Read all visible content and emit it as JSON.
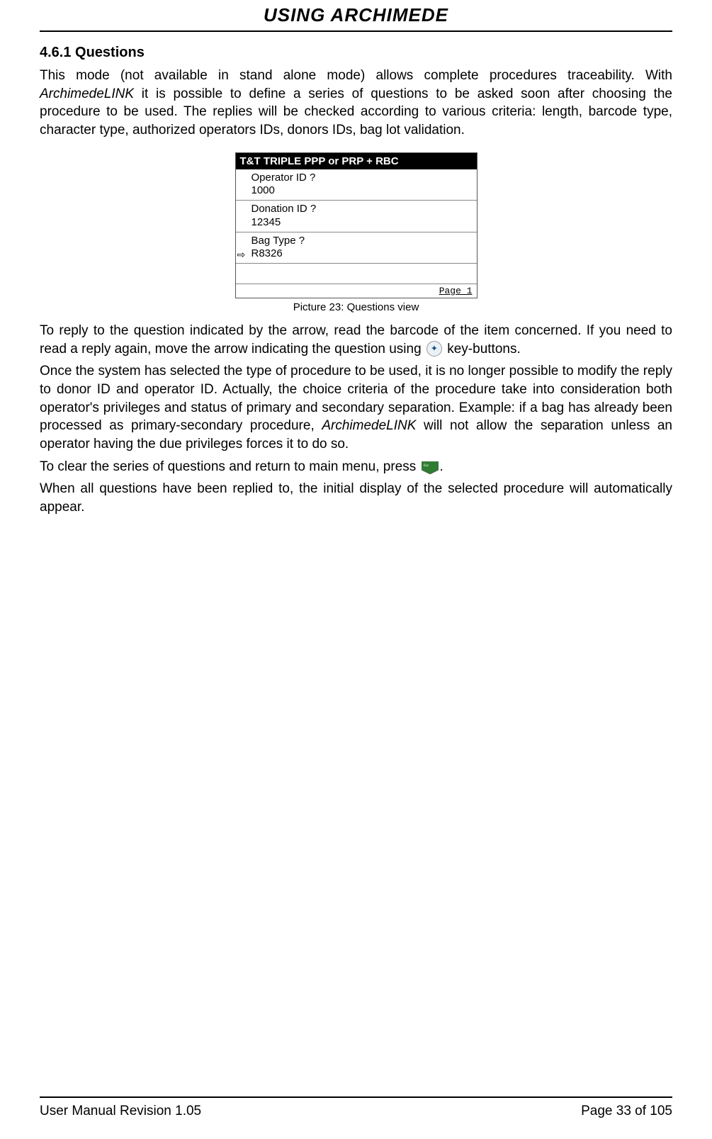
{
  "header": {
    "title": "USING ARCHIMEDE"
  },
  "section": {
    "number_title": "4.6.1 Questions"
  },
  "paragraphs": {
    "p1a": "This mode (not available in stand alone mode) allows complete procedures traceability. With ",
    "p1b": "ArchimedeLINK",
    "p1c": " it is possible to define a series of questions to be asked soon after choosing the procedure to be used. The replies will be checked according to various criteria: length, barcode type, character type, authorized operators IDs, donors IDs, bag lot validation.",
    "p2a": "To reply to the question indicated by the arrow, read the barcode of the item concerned. If you need to read a reply again, move the arrow indicating the question using ",
    "p2b": " key-buttons.",
    "p3a": "Once the system has selected the type of procedure to be used, it is no longer possible to modify the reply to donor ID and operator ID. Actually, the choice criteria of the procedure take into consideration both operator's privileges and status of primary and secondary separation. Example: if a bag has already been processed as primary-secondary procedure, ",
    "p3b": "ArchimedeLINK",
    "p3c": " will not allow the separation unless an operator having the due privileges forces it to do so.",
    "p4a": "To clear the series of questions and return to main menu, press ",
    "p4b": ".",
    "p5": "When all questions have been replied to, the initial display of the selected procedure will automatically appear."
  },
  "figure": {
    "caption": "Picture 23: Questions view",
    "titlebar": "T&T TRIPLE PPP or PRP + RBC",
    "rows": [
      {
        "q": "Operator ID ?",
        "a": "1000",
        "arrow": false
      },
      {
        "q": "Donation ID ?",
        "a": "12345",
        "arrow": false
      },
      {
        "q": "Bag Type ?",
        "a": "R8326",
        "arrow": true
      }
    ],
    "footer": "Page 1"
  },
  "footer": {
    "left": "User Manual Revision 1.05",
    "right": "Page 33 of 105"
  }
}
